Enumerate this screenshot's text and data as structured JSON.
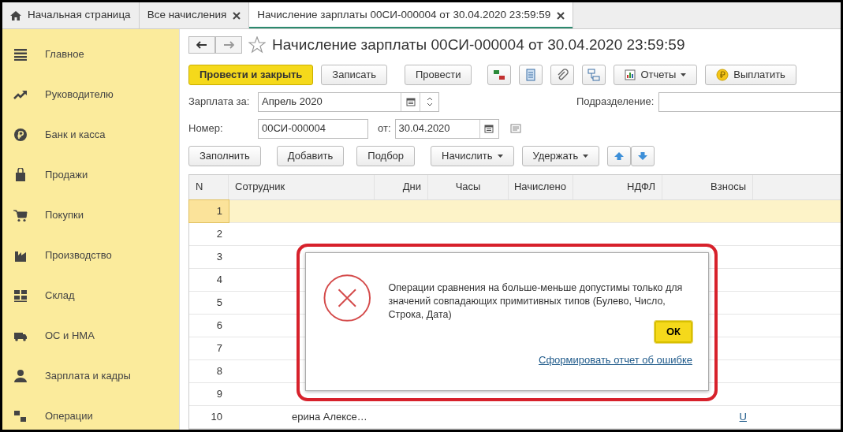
{
  "tabs": [
    {
      "label": "Начальная страница",
      "selected": false
    },
    {
      "label": "Все начисления",
      "selected": false
    },
    {
      "label": "Начисление зарплаты 00СИ-000004 от 30.04.2020 23:59:59",
      "selected": true
    }
  ],
  "sidebar": {
    "items": [
      {
        "label": "Главное"
      },
      {
        "label": "Руководителю"
      },
      {
        "label": "Банк и касса"
      },
      {
        "label": "Продажи"
      },
      {
        "label": "Покупки"
      },
      {
        "label": "Производство"
      },
      {
        "label": "Склад"
      },
      {
        "label": "ОС и НМА"
      },
      {
        "label": "Зарплата и кадры"
      },
      {
        "label": "Операции"
      }
    ]
  },
  "document": {
    "title": "Начисление зарплаты 00СИ-000004 от 30.04.2020 23:59:59",
    "toolbar": [
      {
        "kind": "primary",
        "label": "Провести и закрыть"
      },
      {
        "kind": "button",
        "label": "Записать"
      },
      {
        "kind": "button",
        "label": "Провести"
      },
      {
        "kind": "icon"
      },
      {
        "kind": "icon"
      },
      {
        "kind": "icon"
      },
      {
        "kind": "icon"
      },
      {
        "kind": "dropdown",
        "label": "Отчеты"
      },
      {
        "kind": "pay",
        "label": "Выплатить"
      }
    ],
    "fields": {
      "period_label": "Зарплата за:",
      "period": "Апрель 2020",
      "department_label": "Подразделение:",
      "number_label": "Номер:",
      "number": "00СИ-000004",
      "date_label": "от:",
      "date": "30.04.2020"
    },
    "table_toolbar": [
      {
        "kind": "button",
        "label": "Заполнить"
      },
      {
        "kind": "button",
        "label": "Добавить"
      },
      {
        "kind": "button",
        "label": "Подбор"
      },
      {
        "kind": "dropdown",
        "label": "Начислить"
      },
      {
        "kind": "dropdown",
        "label": "Удержать"
      },
      {
        "kind": "up"
      },
      {
        "kind": "down"
      }
    ],
    "table": {
      "columns": [
        "N",
        "Сотрудник",
        "Дни",
        "Часы",
        "Начислено",
        "НДФЛ",
        "Взносы"
      ],
      "rows": [
        {
          "n": "1",
          "selected": true
        },
        {
          "n": "2",
          "selected": false
        },
        {
          "n": "3",
          "selected": false
        },
        {
          "n": "4",
          "selected": false
        },
        {
          "n": "5",
          "selected": false
        },
        {
          "n": "6",
          "selected": false
        },
        {
          "n": "7",
          "selected": false
        },
        {
          "n": "8",
          "selected": false
        },
        {
          "n": "9",
          "selected": false
        },
        {
          "n": "10",
          "employee": "ерина Алексе…",
          "contrib": "U",
          "selected": false
        }
      ]
    }
  },
  "dialog": {
    "message": "Операции сравнения на больше-меньше допустимы только для значений совпадающих примитивных типов (Булево, Число, Строка, Дата)",
    "ok": "ОК",
    "report_link": "Сформировать отчет об ошибке"
  }
}
